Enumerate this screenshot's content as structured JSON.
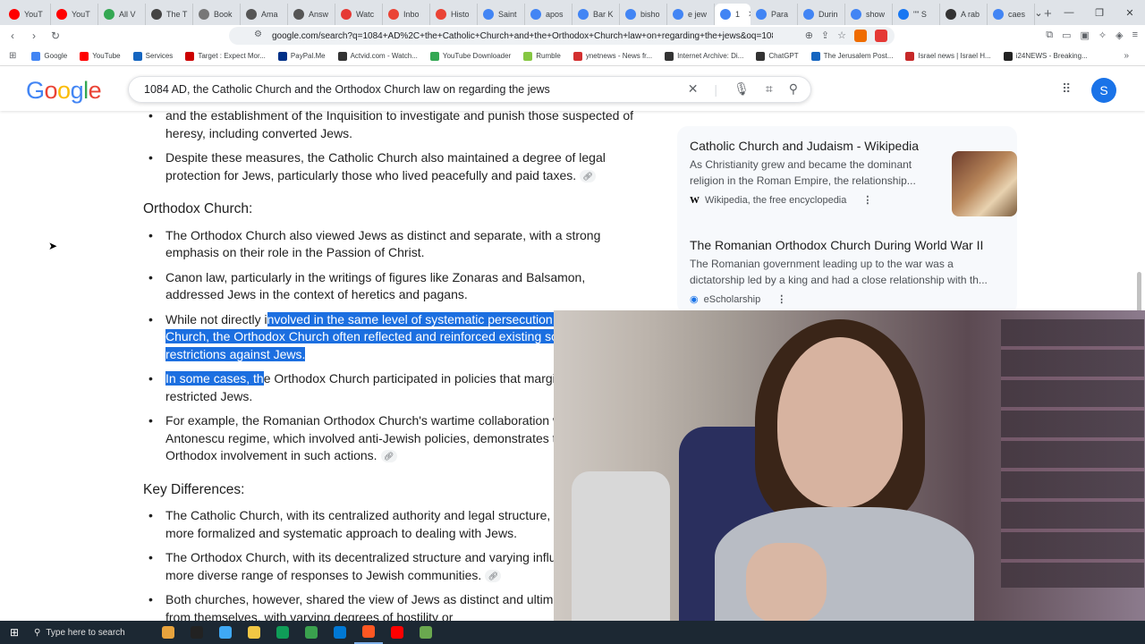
{
  "browser": {
    "tabs": [
      {
        "label": "YouT",
        "color": "#ff0000"
      },
      {
        "label": "YouT",
        "color": "#ff0000"
      },
      {
        "label": "All V",
        "color": "#34a853"
      },
      {
        "label": "The T",
        "color": "#444444"
      },
      {
        "label": "Book",
        "color": "#777777"
      },
      {
        "label": "Ama",
        "color": "#555555"
      },
      {
        "label": "Answ",
        "color": "#555555"
      },
      {
        "label": "Watc",
        "color": "#e53935"
      },
      {
        "label": "Inbo",
        "color": "#ea4335"
      },
      {
        "label": "Histo",
        "color": "#ea4335"
      },
      {
        "label": "Saint",
        "color": "#4285f4"
      },
      {
        "label": "apos",
        "color": "#4285f4"
      },
      {
        "label": "Bar K",
        "color": "#4285f4"
      },
      {
        "label": "bisho",
        "color": "#4285f4"
      },
      {
        "label": "e jew",
        "color": "#4285f4"
      }
    ],
    "active_tab": {
      "label": "1",
      "color": "#4285f4"
    },
    "tabs_after": [
      {
        "label": "Para",
        "color": "#4285f4"
      },
      {
        "label": "Durin",
        "color": "#4285f4"
      },
      {
        "label": "show",
        "color": "#4285f4"
      },
      {
        "label": "\"\" S",
        "color": "#1877f2"
      },
      {
        "label": "A rab",
        "color": "#333333"
      },
      {
        "label": "caes",
        "color": "#4285f4"
      }
    ],
    "new_tab": "+",
    "url": "google.com/search?q=1084+AD%2C+the+Catholic+Church+and+the+Orthodox+Church+law+on+regarding+the+jews&oq=1084+AD%2C+the+Catholic+Church+and+the+Orthodox+Church+law+on+regarding+the+jews&oq=1084+AD%2C+t...",
    "bookmarks": [
      {
        "label": "Google",
        "color": "#4285f4"
      },
      {
        "label": "YouTube",
        "color": "#ff0000"
      },
      {
        "label": "Services",
        "color": "#1565c0"
      },
      {
        "label": "Target : Expect Mor...",
        "color": "#cc0000"
      },
      {
        "label": "PayPal.Me",
        "color": "#003087"
      },
      {
        "label": "Actvid.com - Watch...",
        "color": "#333333"
      },
      {
        "label": "YouTube Downloader",
        "color": "#34a853"
      },
      {
        "label": "Rumble",
        "color": "#85c742"
      },
      {
        "label": "ynetnews - News fr...",
        "color": "#d32f2f"
      },
      {
        "label": "Internet Archive: Di...",
        "color": "#333333"
      },
      {
        "label": "ChatGPT",
        "color": "#333333"
      },
      {
        "label": "The Jerusalem Post...",
        "color": "#1565c0"
      },
      {
        "label": "Israel news | Israel H...",
        "color": "#c62828"
      },
      {
        "label": "i24NEWS - Breaking...",
        "color": "#222222"
      }
    ]
  },
  "google": {
    "logo": "Google",
    "query": "1084 AD, the Catholic Church and the Orthodox Church law on regarding the jews",
    "avatar_letter": "S"
  },
  "article": {
    "top_partial": "and the establishment of the Inquisition to investigate and punish those suspected of heresy, including converted Jews.",
    "catholic_last": "Despite these measures, the Catholic Church also maintained a degree of legal protection for Jews, particularly those who lived peacefully and paid taxes.",
    "orthodox_heading": "Orthodox Church:",
    "orthodox_1": "The Orthodox Church also viewed Jews as distinct and separate, with a strong emphasis on their role in the Passion of Christ.",
    "orthodox_2": "Canon law, particularly in the writings of figures like Zonaras and Balsamon, addressed Jews in the context of heretics and pagans.",
    "orthodox_3_pre": "While not directly i",
    "orthodox_3_hl": "nvolved in the same level of systematic persecution as the Catholic Church, the Orthodox Church often reflected and reinforced existing social and legal restrictions against Jews.",
    "orthodox_4_hl": "In some cases, th",
    "orthodox_4_post": "e Orthodox Church participated in policies that marginalized or restricted Jews.",
    "orthodox_5": "For example, the Romanian Orthodox Church's wartime collaboration with the Antonescu regime, which involved anti-Jewish policies, demonstrates the potential for Orthodox involvement in such actions.",
    "diff_heading": "Key Differences:",
    "diff_1": "The Catholic Church, with its centralized authority and legal structure, developed a more formalized and systematic approach to dealing with Jews.",
    "diff_2": "The Orthodox Church, with its decentralized structure and varying influences, had a more diverse range of responses to Jewish communities.",
    "diff_3": "Both churches, however, shared the view of Jews as distinct and ultimately separate from themselves, with varying degrees of hostility or"
  },
  "sources": [
    {
      "title": "Catholic Church and Judaism - Wikipedia",
      "snippet": "As Christianity grew and became the dominant religion in the Roman Empire, the relationship...",
      "site": "Wikipedia, the free encyclopedia",
      "site_icon": "W"
    },
    {
      "title": "The Romanian Orthodox Church During World War II",
      "snippet": "The Romanian government leading up to the war was a dictatorship led by a king and had a close relationship with th...",
      "site": "eScholarship"
    }
  ],
  "taskbar": {
    "search_placeholder": "Type here to search",
    "apps": [
      "#e8a33d",
      "#222222",
      "#3fa9f5",
      "#f2c744",
      "#0f9d58",
      "#3aa14e",
      "#0078d4",
      "#ff5722",
      "#ff0000",
      "#6aa84f"
    ]
  }
}
